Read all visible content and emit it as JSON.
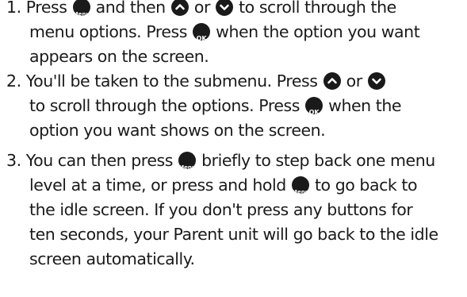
{
  "buttons": {
    "menu": "Menu",
    "ok": "OK",
    "up": "up-arrow-icon",
    "down": "down-arrow-icon"
  },
  "steps": [
    {
      "number": "1.",
      "lines": [
        [
          "Press ",
          " and then ",
          " or ",
          " to scroll through the"
        ],
        [
          "menu options. Press ",
          " when the option you want"
        ],
        [
          "appears on the screen."
        ]
      ]
    },
    {
      "number": "2.",
      "lines": [
        [
          "You'll be taken to the submenu. Press ",
          " or "
        ],
        [
          "to scroll through the options. Press ",
          " when the"
        ],
        [
          "option you want shows on the screen."
        ]
      ]
    },
    {
      "number": "3.",
      "lines": [
        [
          "You can then press ",
          " briefly to step back one menu"
        ],
        [
          "level at a time, or press and hold ",
          " to go back to"
        ],
        [
          "the idle screen. If you don't press any buttons for"
        ],
        [
          "ten seconds, your Parent unit will go back to the idle"
        ],
        [
          "screen automatically."
        ]
      ]
    }
  ],
  "colors": {
    "text": "#1a1a1a",
    "button": "#1a1a1a",
    "button_text": "#ffffff"
  }
}
